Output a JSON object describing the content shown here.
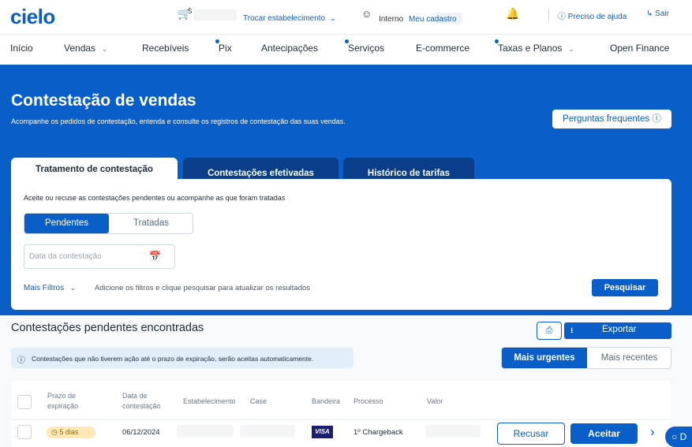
{
  "topbar": {
    "logo": "cielo",
    "store_code": "S",
    "trocar_label": "Trocar estabelecimento",
    "user_prefix": "Interno",
    "user_link": "Meu cadastro",
    "help": "Preciso de ajuda",
    "logout": "Sair"
  },
  "nav": {
    "items": [
      {
        "label": "Início"
      },
      {
        "label": "Vendas"
      },
      {
        "label": "Recebíveis"
      },
      {
        "label": "Pix"
      },
      {
        "label": "Antecipações"
      },
      {
        "label": "Serviços"
      },
      {
        "label": "E-commerce"
      },
      {
        "label": "Taxas e Planos"
      },
      {
        "label": "Open Finance"
      }
    ]
  },
  "hero": {
    "title": "Contestação de vendas",
    "subtitle": "Acompanhe os pedidos de contestação, entenda e consulte os registros de contestação das suas vendas.",
    "faq_button": "Perguntas frequentes"
  },
  "tabs": [
    {
      "label": "Tratamento de contestação",
      "active": true
    },
    {
      "label": "Contestações efetivadas",
      "active": false
    },
    {
      "label": "Histórico de tarifas",
      "active": false
    }
  ],
  "filter_card": {
    "description": "Aceite ou recuse as contestações pendentes ou acompanhe as que foram tratadas",
    "segment": {
      "pending": "Pendentes",
      "treated": "Tratadas",
      "selected": "Pendentes"
    },
    "date_placeholder": "Data da contestação",
    "more_filters": "Mais Filtros",
    "hint": "Adicione os filtros e clique pesquisar para atualizar os resultados",
    "search_button": "Pesquisar"
  },
  "results": {
    "title": "Contestações pendentes encontradas",
    "export_button": "Exportar",
    "info": "Contestações que não tiverem ação até o prazo de expiração, serão aceitas automaticamente.",
    "sort": {
      "urgent": "Mais urgentes",
      "recent": "Mais recentes",
      "selected": "Mais urgentes"
    }
  },
  "table": {
    "headers": {
      "expiration": "Prazo de expiração",
      "date": "Data de contestação",
      "establishment": "Estabelecimento",
      "case": "Case",
      "brand": "Bandeira",
      "process": "Processo",
      "value": "Valor"
    },
    "rows": [
      {
        "expiration": "5 dias",
        "date": "06/12/2024",
        "brand": "VISA",
        "process": "1º Chargeback"
      }
    ],
    "actions": {
      "reject": "Recusar",
      "accept": "Aceitar"
    }
  },
  "chat_label": "D",
  "colors": {
    "brand": "#0a5ec7",
    "tab_dark": "#0a3d8a",
    "badge": "#ffe8b3",
    "info_bg": "#e3eefb"
  }
}
